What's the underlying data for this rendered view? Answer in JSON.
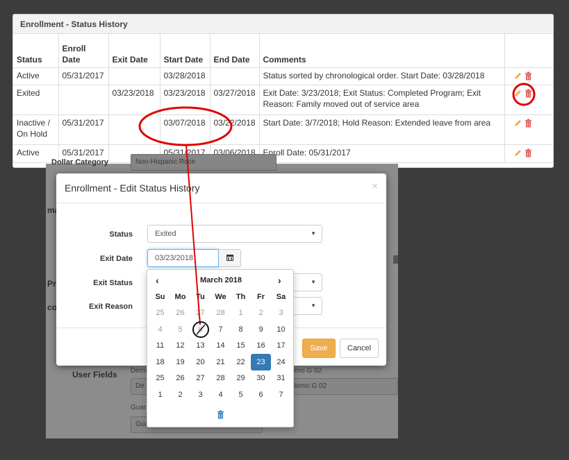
{
  "history": {
    "title": "Enrollment - Status History",
    "columns": [
      "Status",
      "Enroll Date",
      "Exit Date",
      "Start Date",
      "End Date",
      "Comments",
      ""
    ],
    "rows": [
      {
        "status": "Active",
        "enroll_date": "05/31/2017",
        "exit_date": "",
        "start_date": "03/28/2018",
        "end_date": "",
        "comments": "Status sorted by chronological order. Start Date: 03/28/2018"
      },
      {
        "status": "Exited",
        "enroll_date": "",
        "exit_date": "03/23/2018",
        "start_date": "03/23/2018",
        "end_date": "03/27/2018",
        "comments": "Exit Date: 3/23/2018; Exit Status: Completed Program; Exit Reason: Family moved out of service area"
      },
      {
        "status": "Inactive / On Hold",
        "enroll_date": "05/31/2017",
        "exit_date": "",
        "start_date": "03/07/2018",
        "end_date": "03/22/2018",
        "comments": "Start Date: 3/7/2018; Hold Reason: Extended leave from area"
      },
      {
        "status": "Active",
        "enroll_date": "05/31/2017",
        "exit_date": "",
        "start_date": "05/31/2017",
        "end_date": "03/06/2018",
        "comments": "Enroll Date: 05/31/2017"
      }
    ],
    "icons": {
      "edit": "pencil-icon",
      "delete": "trash-icon"
    }
  },
  "background": {
    "category_label": "Dollar Category",
    "category_value": "Non-Hispanic Race",
    "left_fragments": [
      "mai",
      "Pri",
      "co"
    ],
    "user_fields_label": "User Fields",
    "demo_left_label": "Demo",
    "demo_left_value": "De",
    "demo_right_label": "Demo G 02",
    "demo_right_value": "Demo G 02",
    "guardian_label": "Guar",
    "guardian_value": "Guardian Relationship - Demo"
  },
  "modal": {
    "title": "Enrollment - Edit Status History",
    "close": "×",
    "status_label": "Status",
    "status_value": "Exited",
    "exit_date_label": "Exit Date",
    "exit_date_value": "03/23/2018",
    "exit_status_label": "Exit Status",
    "exit_reason_label": "Exit Reason",
    "save_label": "Save",
    "cancel_label": "Cancel"
  },
  "datepicker": {
    "title": "March 2018",
    "prev": "‹",
    "next": "›",
    "weekdays": [
      "Su",
      "Mo",
      "Tu",
      "We",
      "Th",
      "Fr",
      "Sa"
    ],
    "weeks": [
      [
        "25",
        "26",
        "27",
        "28",
        "1",
        "2",
        "3"
      ],
      [
        "4",
        "5",
        "6",
        "7",
        "8",
        "9",
        "10"
      ],
      [
        "11",
        "12",
        "13",
        "14",
        "15",
        "16",
        "17"
      ],
      [
        "18",
        "19",
        "20",
        "21",
        "22",
        "23",
        "24"
      ],
      [
        "25",
        "26",
        "27",
        "28",
        "29",
        "30",
        "31"
      ],
      [
        "1",
        "2",
        "3",
        "4",
        "5",
        "6",
        "7"
      ]
    ],
    "selected": "23",
    "crossed_out": "6"
  },
  "colors": {
    "accent": "#337ab7",
    "save": "#f0ad4e",
    "delete": "#d9534f",
    "edit": "#f0ad4e",
    "annotation_red": "#e00000"
  }
}
